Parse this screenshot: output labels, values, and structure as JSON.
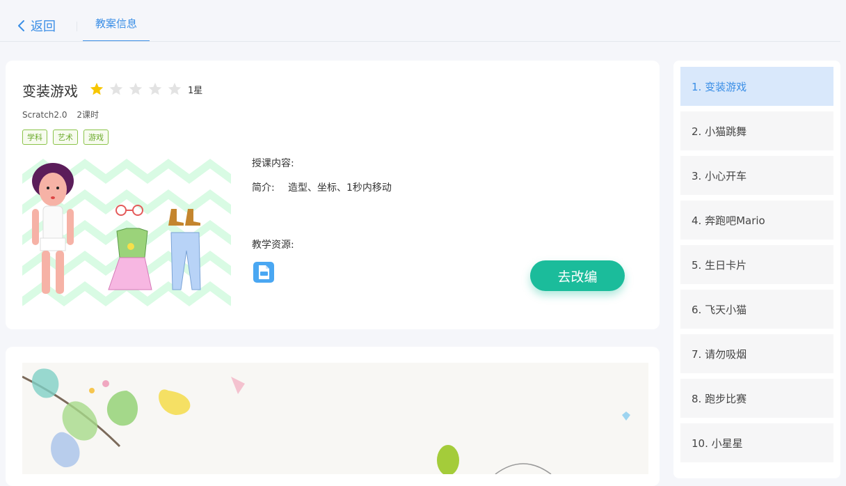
{
  "header": {
    "back_label": "返回",
    "tab_label": "教案信息"
  },
  "lesson": {
    "title": "变装游戏",
    "rating": 1,
    "rating_max": 5,
    "rating_label": "1星",
    "version": "Scratch2.0",
    "hours": "2课时",
    "tags": [
      "学科",
      "艺术",
      "游戏"
    ],
    "content_label": "授课内容:",
    "intro_label": "简介:",
    "intro_text": "造型、坐标、1秒内移动",
    "resources_label": "教学资源:",
    "resource_icon": "pdf-file-icon",
    "edit_button": "去改编"
  },
  "sidebar": {
    "items": [
      {
        "label": "1. 变装游戏",
        "active": true
      },
      {
        "label": "2. 小猫跳舞",
        "active": false
      },
      {
        "label": "3. 小心开车",
        "active": false
      },
      {
        "label": "4. 奔跑吧Mario",
        "active": false
      },
      {
        "label": "5. 生日卡片",
        "active": false
      },
      {
        "label": "6. 飞天小猫",
        "active": false
      },
      {
        "label": "7. 请勿吸烟",
        "active": false
      },
      {
        "label": "8. 跑步比赛",
        "active": false
      },
      {
        "label": "10. 小星星",
        "active": false
      }
    ]
  },
  "colors": {
    "accent": "#3a8ee6",
    "button": "#1bbc9b",
    "star_on": "#f7c600",
    "star_off": "#e3e3e3",
    "tag": "#8bc34a"
  }
}
